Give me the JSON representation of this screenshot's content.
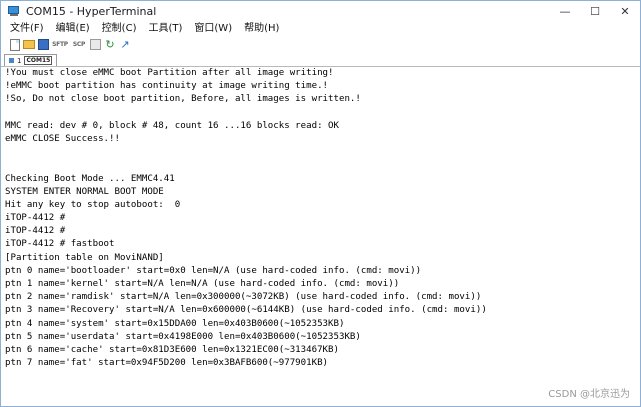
{
  "window": {
    "title": "COM15 - HyperTerminal"
  },
  "controls": {
    "minimize": "—",
    "maximize": "☐",
    "close": "✕"
  },
  "menu": [
    {
      "label": "文件(F)"
    },
    {
      "label": "编辑(E)"
    },
    {
      "label": "控制(C)"
    },
    {
      "label": "工具(T)"
    },
    {
      "label": "窗口(W)"
    },
    {
      "label": "帮助(H)"
    }
  ],
  "toolbar": {
    "icons": [
      "new-document-icon",
      "open-folder-icon",
      "save-icon",
      "sftp-icon",
      "scp-icon",
      "properties-icon",
      "reconnect-icon",
      "disconnect-icon"
    ],
    "sftp_label": "SFTP",
    "scp_label": "SCP"
  },
  "tabs": [
    {
      "index": "1",
      "label": "COM15"
    }
  ],
  "terminal": {
    "lines": [
      "!You must close eMMC boot Partition after all image writing!",
      "!eMMC boot partition has continuity at image writing time.!",
      "!So, Do not close boot partition, Before, all images is written.!",
      "",
      "MMC read: dev # 0, block # 48, count 16 ...16 blocks read: OK",
      "eMMC CLOSE Success.!!",
      "",
      "",
      "Checking Boot Mode ... EMMC4.41",
      "SYSTEM ENTER NORMAL BOOT MODE",
      "Hit any key to stop autoboot:  0",
      "iTOP-4412 #",
      "iTOP-4412 #",
      "iTOP-4412 # fastboot",
      "[Partition table on MoviNAND]",
      "ptn 0 name='bootloader' start=0x0 len=N/A (use hard-coded info. (cmd: movi))",
      "ptn 1 name='kernel' start=N/A len=N/A (use hard-coded info. (cmd: movi))",
      "ptn 2 name='ramdisk' start=N/A len=0x300000(~3072KB) (use hard-coded info. (cmd: movi))",
      "ptn 3 name='Recovery' start=N/A len=0x600000(~6144KB) (use hard-coded info. (cmd: movi))",
      "ptn 4 name='system' start=0x15DDA00 len=0x403B0600(~1052353KB)",
      "ptn 5 name='userdata' start=0x4198E000 len=0x403B0600(~1052353KB)",
      "ptn 6 name='cache' start=0x81D3E600 len=0x1321EC00(~313467KB)",
      "ptn 7 name='fat' start=0x94F5D200 len=0x3BAFB600(~977901KB)"
    ]
  },
  "watermark": "CSDN @北京迅为"
}
